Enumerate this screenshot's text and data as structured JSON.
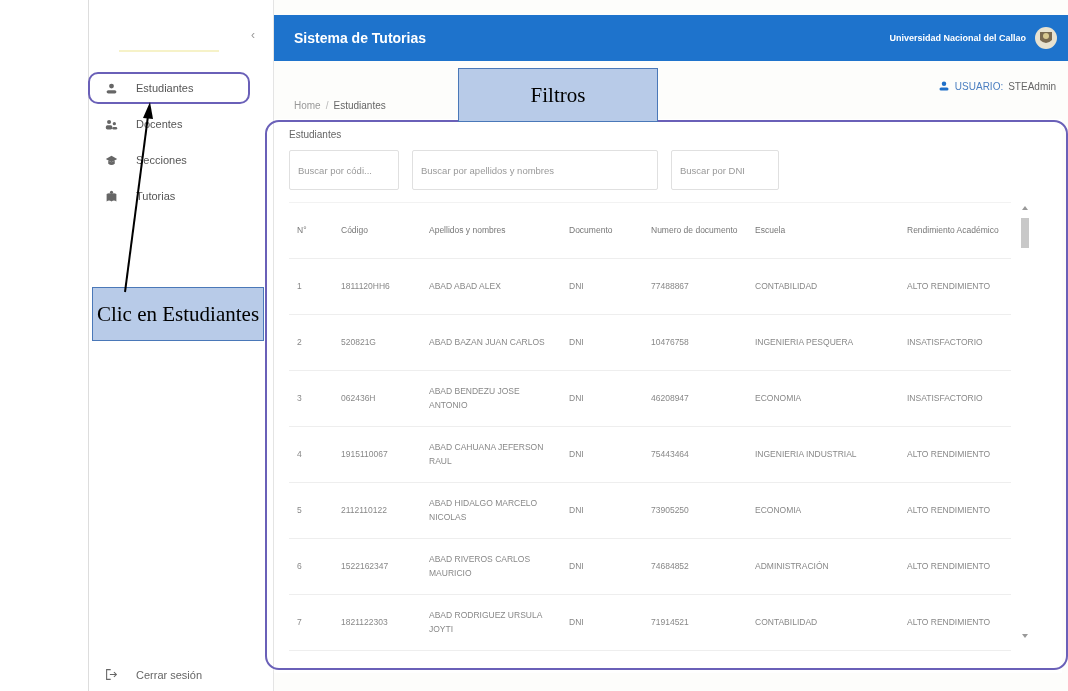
{
  "sidebar": {
    "collapse": "‹",
    "items": [
      {
        "kind": "student",
        "label": "Estudiantes"
      },
      {
        "kind": "teacher",
        "label": "Docentes"
      },
      {
        "kind": "section",
        "label": "Secciones"
      },
      {
        "kind": "tutoring",
        "label": "Tutorias"
      }
    ],
    "logout": "Cerrar sesión"
  },
  "header": {
    "title": "Sistema de Tutorias",
    "university": "Universidad Nacional del Callao"
  },
  "breadcrumb": [
    "Home",
    "/",
    "Estudiantes"
  ],
  "user": {
    "label": "USUARIO:",
    "name": "STEAdmin"
  },
  "card": {
    "title": "Estudiantes",
    "filters": [
      {
        "placeholder": "Buscar por códi..."
      },
      {
        "placeholder": "Buscar por apellidos y nombres"
      },
      {
        "placeholder": "Buscar por DNI"
      }
    ],
    "table": {
      "columns": [
        "N°",
        "Código",
        "Apellidos y nombres",
        "Documento",
        "Numero de documento",
        "Escuela",
        "Rendimiento Académico"
      ],
      "rows": [
        [
          "1",
          "1811120HH6",
          "ABAD ABAD ALEX",
          "DNI",
          "77488867",
          "CONTABILIDAD",
          "ALTO RENDIMIENTO"
        ],
        [
          "2",
          "520821G",
          "ABAD BAZAN JUAN CARLOS",
          "DNI",
          "10476758",
          "INGENIERIA PESQUERA",
          "INSATISFACTORIO"
        ],
        [
          "3",
          "062436H",
          "ABAD BENDEZU JOSE ANTONIO",
          "DNI",
          "46208947",
          "ECONOMIA",
          "INSATISFACTORIO"
        ],
        [
          "4",
          "1915110067",
          "ABAD CAHUANA JEFERSON RAUL",
          "DNI",
          "75443464",
          "INGENIERIA INDUSTRIAL",
          "ALTO RENDIMIENTO"
        ],
        [
          "5",
          "2112110122",
          "ABAD HIDALGO MARCELO NICOLAS",
          "DNI",
          "73905250",
          "ECONOMIA",
          "ALTO RENDIMIENTO"
        ],
        [
          "6",
          "1522162347",
          "ABAD RIVEROS CARLOS MAURICIO",
          "DNI",
          "74684852",
          "ADMINISTRACIÓN",
          "ALTO RENDIMIENTO"
        ],
        [
          "7",
          "1821122303",
          "ABAD RODRIGUEZ URSULA JOYTI",
          "DNI",
          "71914521",
          "CONTABILIDAD",
          "ALTO RENDIMIENTO"
        ]
      ]
    }
  },
  "annotations": [
    {
      "kind": "callout",
      "text": "Filtros"
    },
    {
      "kind": "callout",
      "text": "Clic en Estudiantes"
    }
  ]
}
